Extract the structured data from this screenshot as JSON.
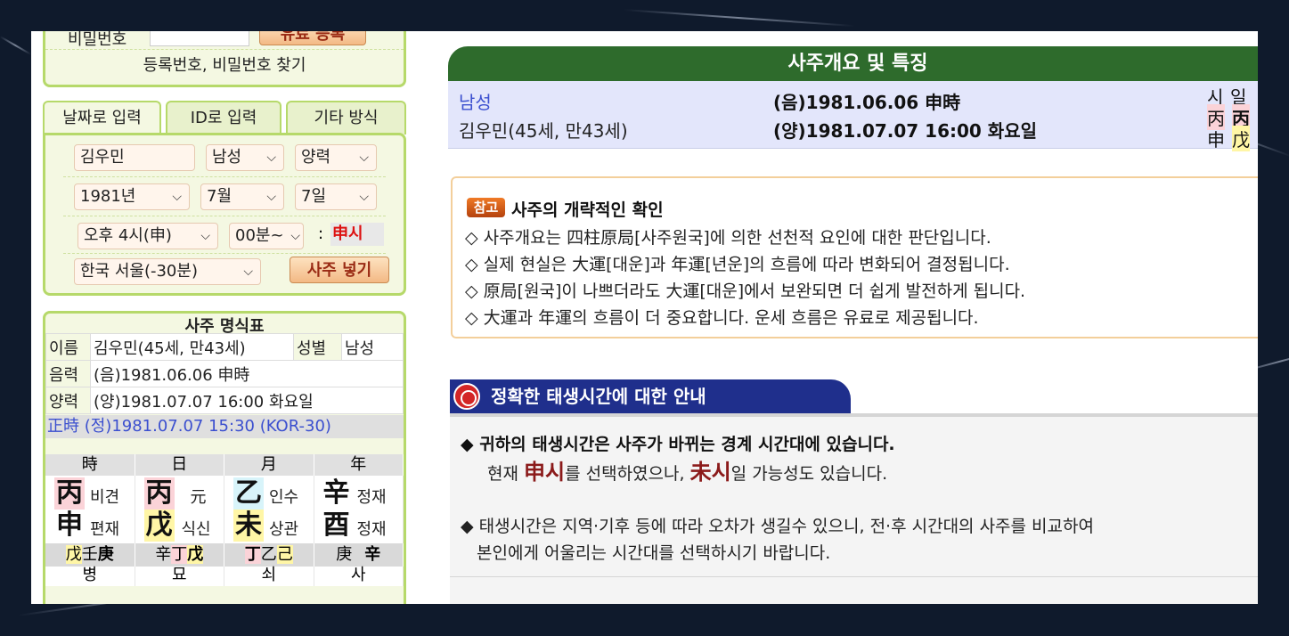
{
  "login": {
    "password_label": "비밀번호",
    "paid_register_label": "유료 등록",
    "find_link": "등록번호, 비밀번호 찾기"
  },
  "tabs": [
    {
      "label": "날짜로 입력",
      "active": true
    },
    {
      "label": "ID로 입력",
      "active": false
    },
    {
      "label": "기타 방식",
      "active": false
    }
  ],
  "form": {
    "name_value": "김우민",
    "gender_selected": "남성",
    "calendar_selected": "양력",
    "year_selected": "1981년",
    "month_selected": "7월",
    "day_selected": "7일",
    "hour_selected": "오후 4시(申)",
    "minute_selected": "00분~",
    "colon": ":",
    "hour_result": "申시",
    "region_selected": "한국 서울(-30분)",
    "submit_label": "사주 넣기"
  },
  "chart": {
    "title": "사주 명식표",
    "name_label": "이름",
    "name_value": "김우민(45세, 만43세)",
    "gender_label": "성별",
    "gender_value": "남성",
    "lunar_label": "음력",
    "lunar_value": "(음)1981.06.06 申時",
    "solar_label": "양력",
    "solar_value": "(양)1981.07.07 16:00 화요일",
    "jungsi": "正時 (정)1981.07.07 15:30 (KOR-30)",
    "pillar_heads": [
      "時",
      "日",
      "月",
      "年"
    ],
    "pillars": [
      {
        "stem": "丙",
        "stem_god": "비견",
        "branch": "申",
        "branch_god": "편재"
      },
      {
        "stem": "丙",
        "stem_god": "元",
        "branch": "戊",
        "branch_god": "식신"
      },
      {
        "stem": "乙",
        "stem_god": "인수",
        "branch": "未",
        "branch_god": "상관"
      },
      {
        "stem": "辛",
        "stem_god": "정재",
        "branch": "酉",
        "branch_god": "정재"
      }
    ],
    "hidden_stems": [
      [
        "戊",
        "壬",
        "庚"
      ],
      [
        "辛",
        "丁",
        "戊"
      ],
      [
        "丁",
        "乙",
        "己"
      ],
      [
        "庚",
        "",
        "辛"
      ]
    ],
    "twelve_stages": [
      "병",
      "묘",
      "쇠",
      "사"
    ]
  },
  "overview": {
    "header": "사주개요 및 특징",
    "gender": "남성",
    "name_age": "김우민(45세, 만43세)",
    "lunar": "(음)1981.06.06 申時",
    "solar": "(양)1981.07.07 16:00 화요일",
    "mini_heads": [
      "시",
      "일"
    ],
    "mini_stems": [
      "丙",
      "丙"
    ],
    "mini_branches": [
      "申",
      "戊"
    ]
  },
  "note": {
    "badge": "참고",
    "title": "사주의 개략적인 확인",
    "lines": [
      "◇ 사주개요는 四柱原局[사주원국]에 의한 선천적 요인에 대한 판단입니다.",
      "◇ 실제 현실은 大運[대운]과 年運[년운]의 흐름에 따라 변화되어 결정됩니다.",
      "◇ 原局[원국]이 나쁘더라도 大運[대운]에서 보완되면 더 쉽게 발전하게 됩니다.",
      "◇ 大運과 年運의 흐름이 더 중요합니다. 운세 흐름은 유료로 제공됩니다."
    ]
  },
  "birth": {
    "header": "정확한 태생시간에 대한 안내",
    "line1": "◆ 귀하의 태생시간은 사주가 바뀌는 경계 시간대에 있습니다.",
    "line2_prefix": "현재 ",
    "line2_hour1": "申시",
    "line2_mid": "를 선택하였으나, ",
    "line2_hour2": "未시",
    "line2_suffix": "일 가능성도 있습니다.",
    "line3": "◆ 태생시간은 지역·기후 등에 따라 오차가 생길수 있으니, 전·후 시간대의 사주를 비교하여",
    "line4": "본인에게 어울리는 시간대를 선택하시기 바랍니다."
  }
}
